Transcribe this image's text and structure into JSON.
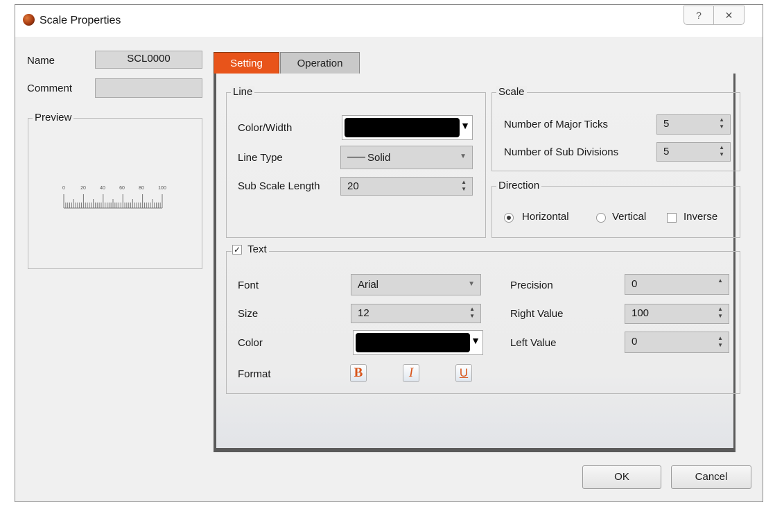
{
  "window": {
    "title": "Scale Properties",
    "help_icon": "?",
    "close_icon": "✕"
  },
  "left": {
    "name_label": "Name",
    "name_value": "SCL0000",
    "comment_label": "Comment",
    "comment_value": "",
    "preview_title": "Preview",
    "preview_ticks": [
      "0",
      "20",
      "40",
      "60",
      "80",
      "100"
    ]
  },
  "tabs": [
    {
      "label": "Setting",
      "active": true
    },
    {
      "label": "Operation",
      "active": false
    }
  ],
  "line": {
    "title": "Line",
    "color_width_label": "Color/Width",
    "line_type_label": "Line Type",
    "line_type_value": "Solid",
    "sub_scale_length_label": "Sub Scale Length",
    "sub_scale_length_value": "20"
  },
  "scale": {
    "title": "Scale",
    "major_ticks_label": "Number of Major Ticks",
    "major_ticks_value": "5",
    "sub_divisions_label": "Number of Sub Divisions",
    "sub_divisions_value": "5"
  },
  "direction": {
    "title": "Direction",
    "horizontal_label": "Horizontal",
    "vertical_label": "Vertical",
    "inverse_label": "Inverse",
    "selected": "Horizontal"
  },
  "text": {
    "title": "Text",
    "enabled": true,
    "font_label": "Font",
    "font_value": "Arial",
    "size_label": "Size",
    "size_value": "12",
    "color_label": "Color",
    "format_label": "Format",
    "bold_glyph": "B",
    "italic_glyph": "I",
    "underline_glyph": "U",
    "precision_label": "Precision",
    "precision_value": "0",
    "right_value_label": "Right Value",
    "right_value": "100",
    "left_value_label": "Left Value",
    "left_value": "0"
  },
  "buttons": {
    "ok": "OK",
    "cancel": "Cancel"
  },
  "colors": {
    "accent": "#e8541a",
    "line_color": "#000000",
    "text_color": "#000000"
  }
}
